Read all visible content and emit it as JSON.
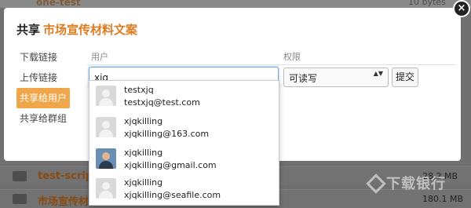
{
  "background": {
    "top_row": {
      "name": "one-test",
      "size": "10 bytes"
    },
    "rows": [
      {
        "name": "test-scripts",
        "size": "28.2 MB"
      },
      {
        "name": "市场宣传材料",
        "size": "180.1 MB"
      }
    ]
  },
  "dialog": {
    "title": "共享",
    "item_name": "市场宣传材料文案",
    "close_glyph": "×",
    "nav": [
      {
        "label": "下载链接"
      },
      {
        "label": "上传链接"
      },
      {
        "label": "共享给用户"
      },
      {
        "label": "共享给群组"
      }
    ],
    "columns": {
      "user": "用户",
      "permission": "权限"
    },
    "user_input_value": "xjq",
    "permission_selected": "可读写",
    "permission_arrow": "▲▼",
    "submit_label": "提交",
    "suggestions": [
      {
        "name": "testxjq",
        "email": "testxjq@test.com"
      },
      {
        "name": "xjqkilling",
        "email": "xjqkilling@163.com"
      },
      {
        "name": "xjqkilling",
        "email": "xjqkilling@gmail.com"
      },
      {
        "name": "xjqkilling",
        "email": "xjqkilling@seafile.com"
      }
    ]
  },
  "watermark": "下载银行",
  "colors": {
    "accent": "#e07a1f",
    "active_nav": "#f0a64a",
    "focus_border": "#6ea3d9"
  },
  "icons": [
    "close-icon",
    "folder-icon",
    "user-avatar-icon",
    "select-arrow-icon"
  ]
}
